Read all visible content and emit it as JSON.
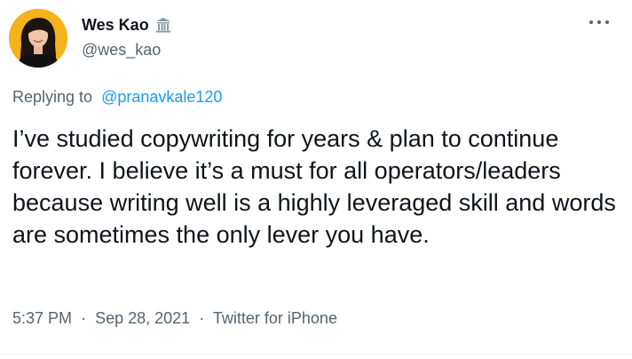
{
  "author": {
    "display_name": "Wes Kao",
    "handle": "@wes_kao",
    "badge_icon": "government-building-icon"
  },
  "reply": {
    "prefix": "Replying to",
    "mention": "@pranavkale120"
  },
  "tweet": {
    "text": "I’ve studied copywriting for years & plan to continue forever. I believe it’s a must for all operators/leaders because writing well is a highly leveraged skill and words are sometimes the only lever you have."
  },
  "meta": {
    "time": "5:37 PM",
    "separator": "·",
    "date": "Sep 28, 2021",
    "source": "Twitter for iPhone"
  },
  "colors": {
    "text_primary": "#0f1419",
    "text_secondary": "#536471",
    "link": "#1d9bf0",
    "avatar_background": "#f4b21b"
  }
}
